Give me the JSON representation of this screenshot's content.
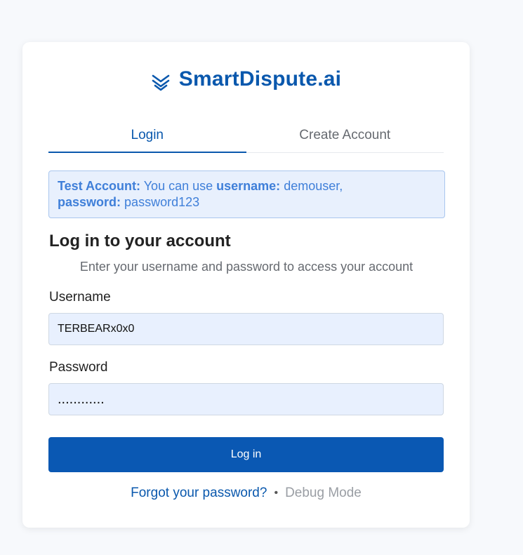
{
  "brand": {
    "name": "SmartDispute.ai",
    "icon": "double-chevron-down-icon",
    "color": "#0a58ad"
  },
  "tabs": [
    {
      "label": "Login",
      "active": true
    },
    {
      "label": "Create Account",
      "active": false
    }
  ],
  "notice": {
    "title": "Test Account:",
    "text_before": "You can use",
    "username_label": "username:",
    "username_value": "demouser,",
    "password_label": "password:",
    "password_value": "password123"
  },
  "form": {
    "heading": "Log in to your account",
    "subheading": "Enter your username and password to access your account",
    "username_label": "Username",
    "username_value": "TERBEARx0x0",
    "password_label": "Password",
    "password_value": "............",
    "submit_label": "Log in"
  },
  "footer": {
    "forgot_label": "Forgot your password?",
    "separator": "•",
    "debug_label": "Debug Mode"
  },
  "colors": {
    "accent": "#0a58ad",
    "button": "#0a58b3",
    "notice_bg": "#e8f0fd",
    "notice_text": "#3f7fd9"
  }
}
